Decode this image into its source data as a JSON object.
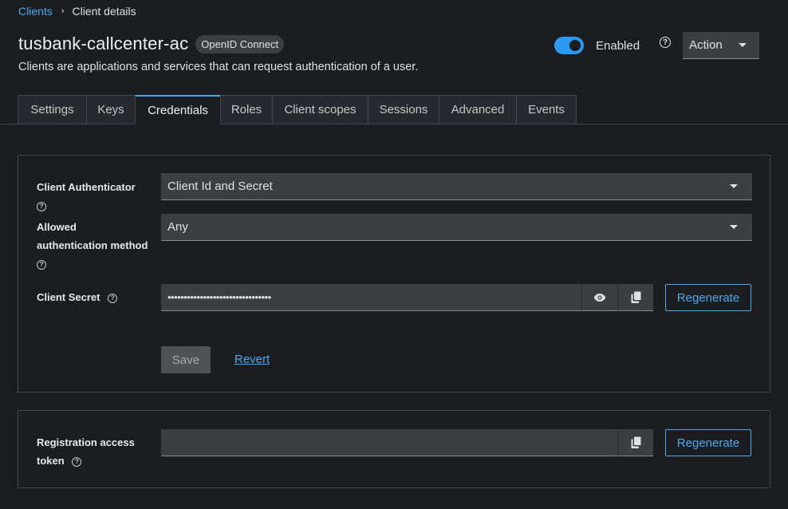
{
  "breadcrumb": {
    "parent": "Clients",
    "separator": "›",
    "current": "Client details"
  },
  "header": {
    "title": "tusbank-callcenter-ac",
    "badge": "OpenID Connect",
    "subtitle": "Clients are applications and services that can request authentication of a user.",
    "toggle_label": "Enabled",
    "toggle_on": true,
    "help_icon": "?",
    "action_label": "Action"
  },
  "tabs": [
    {
      "label": "Settings"
    },
    {
      "label": "Keys"
    },
    {
      "label": "Credentials",
      "active": true
    },
    {
      "label": "Roles"
    },
    {
      "label": "Client scopes"
    },
    {
      "label": "Sessions"
    },
    {
      "label": "Advanced"
    },
    {
      "label": "Events"
    }
  ],
  "credentials": {
    "client_authenticator_label": "Client Authenticator",
    "client_authenticator_value": "Client Id and Secret",
    "allowed_method_label_1": "Allowed",
    "allowed_method_label_2": "authentication method",
    "allowed_method_value": "Any",
    "client_secret_label": "Client Secret",
    "client_secret_value": "••••••••••••••••••••••••••••••••",
    "regenerate_label": "Regenerate",
    "save_label": "Save",
    "revert_label": "Revert",
    "help_icon": "?"
  },
  "registration": {
    "label_1": "Registration access",
    "label_2": "token",
    "value": "",
    "regenerate_label": "Regenerate",
    "help_icon": "?"
  },
  "colors": {
    "accent": "#4fa8ea",
    "toggle": "#2b9af3",
    "background": "#1b1d21",
    "field": "#3c3f42"
  },
  "icons": [
    "chevron-right-icon",
    "help-icon",
    "caret-down-icon",
    "eye-icon",
    "copy-icon"
  ]
}
